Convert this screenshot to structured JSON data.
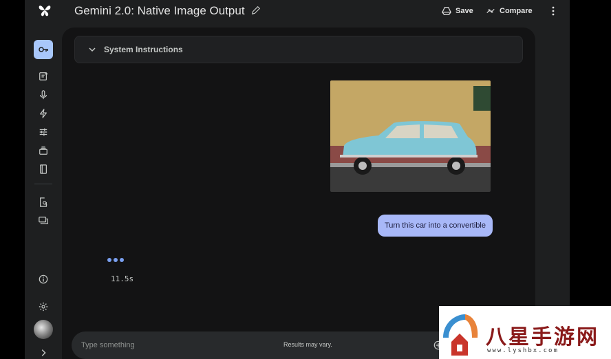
{
  "header": {
    "title": "Gemini 2.0: Native Image Output",
    "save_label": "Save",
    "compare_label": "Compare"
  },
  "system_instructions": {
    "label": "System Instructions"
  },
  "chat": {
    "user_message": "Turn this car into a convertible",
    "elapsed": "11.5s"
  },
  "input": {
    "placeholder": "Type something",
    "note": "Results may vary."
  },
  "watermark": {
    "text": "八星手游网",
    "url": "www.lyshbx.com"
  },
  "colors": {
    "background": "#1e1f20",
    "panel": "#131314",
    "accent": "#a8c7fa",
    "user_bubble": "#a8b8f8"
  }
}
